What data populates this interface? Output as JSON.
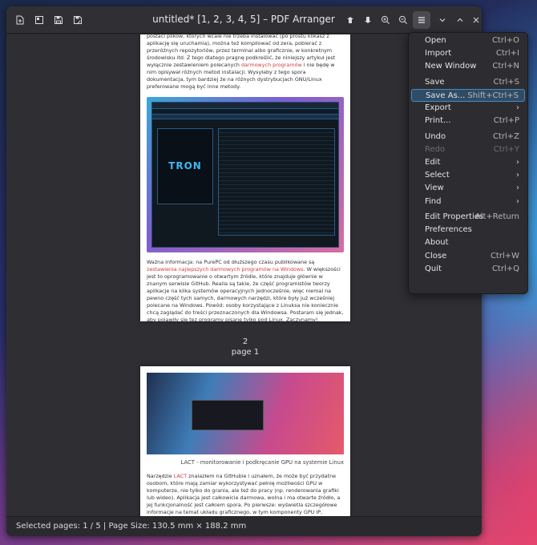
{
  "window": {
    "title": "untitled* [1, 2, 3, 4, 5] – PDF Arranger"
  },
  "toolbar": {
    "left_icons": [
      "import-icon",
      "export-icon",
      "save-icon",
      "save-as-icon"
    ],
    "right_icons": [
      "rotate-left-icon",
      "rotate-right-icon",
      "zoom-in-icon",
      "zoom-out-icon",
      "hamburger-menu-icon",
      "minimize-icon",
      "maximize-icon",
      "close-icon"
    ]
  },
  "page1": {
    "para_top": "postaci plików, których wcale nie trzeba instalować (po prostu klikasz z aplikację się uruchamia), można też kompilować od zera, pobierać z przeróżnych repozytoriów, przez terminal albo graficznie, w konkretnym środowisku itd. Z tego dlatego pragnę podkreślić, że niniejszy artykuł jest wyłącznie zestawieniem polecanych",
    "para_top_link": "darmowych programów",
    "para_top_end": "i nie będę w nim opisywał różnych metod instalacji. Wysyłaby z tego spora dokumentacja, tym bardziej że na różnych dystrybucjach GNU/Linux preferowane mogą być inne metody.",
    "art_text": "TRON",
    "para_bottom_start": "Ważna informacja: na PurePC od dłuższego czasu publikowane są",
    "para_bottom_link": "zestawienia najlepszych darmowych programów na Windows",
    "para_bottom_end": ". W większości jest to oprogramowanie o otwartym źródle, które znajduje głównie w znanym serwisie GitHub. Realia są takie, że część programistów tworzy aplikacje na kilka systemów operacyjnych jednocześnie, więc niemal na pewno część tych samych, darmowych narzędzi, które były już wcześniej polecane na Windows. Powód: osoby korzystające z Linuksa nie koniecznie chcą zaglądać do treści przeznaczonych dla Windowsa. Postaram się jednak, aby pojawiły się tez programy pisane tylko pod Linux. Zaczynamy!"
  },
  "page_label": {
    "number": "2",
    "text": "page 1"
  },
  "page2": {
    "caption": "LACT - monitorowanie i podkręcanie GPU na systemie Linux",
    "para_start": "Narzędzie",
    "para_link": "LACT",
    "para_end": "znalazłem na GitHubie i uznałem, że może być przydatne osobom, które mają zamiar wykorzystywać pełnię możliwości GPU w komputerze, nie tylko do grania, ale też do pracy (np. renderowania grafiki lub wideo). Aplikacja jest całkowicie darmowa, wolna i ma otwarte źródło, a jej funkcjonalność jest całkiem spora. Po pierwsze: wyświetla szczegółowe informacje na temat układu graficznego, w tym komponenty GPU IP, informacje o cache, wspierane funkcje"
  },
  "statusbar": {
    "text": "Selected pages: 1 / 5 | Page Size: 130.5 mm × 188.2 mm"
  },
  "menu": {
    "items": [
      {
        "label": "Open",
        "accel": "Ctrl+O"
      },
      {
        "label": "Import",
        "accel": "Ctrl+I"
      },
      {
        "label": "New Window",
        "accel": "Ctrl+N"
      },
      {
        "label": "Save",
        "accel": "Ctrl+S"
      },
      {
        "label": "Save As...",
        "accel": "Shift+Ctrl+S"
      },
      {
        "label": "Export",
        "accel": ""
      },
      {
        "label": "Print...",
        "accel": "Ctrl+P"
      },
      {
        "label": "Undo",
        "accel": "Ctrl+Z"
      },
      {
        "label": "Redo",
        "accel": "Ctrl+Y"
      },
      {
        "label": "Edit",
        "accel": ""
      },
      {
        "label": "Select",
        "accel": ""
      },
      {
        "label": "View",
        "accel": ""
      },
      {
        "label": "Find",
        "accel": ""
      },
      {
        "label": "Edit Properties",
        "accel": "Alt+Return"
      },
      {
        "label": "Preferences",
        "accel": ""
      },
      {
        "label": "About",
        "accel": ""
      },
      {
        "label": "Close",
        "accel": "Ctrl+W"
      },
      {
        "label": "Quit",
        "accel": "Ctrl+Q"
      }
    ]
  },
  "colors": {
    "menu_highlight": "#2f4c66",
    "link_red": "#d43a3a"
  }
}
